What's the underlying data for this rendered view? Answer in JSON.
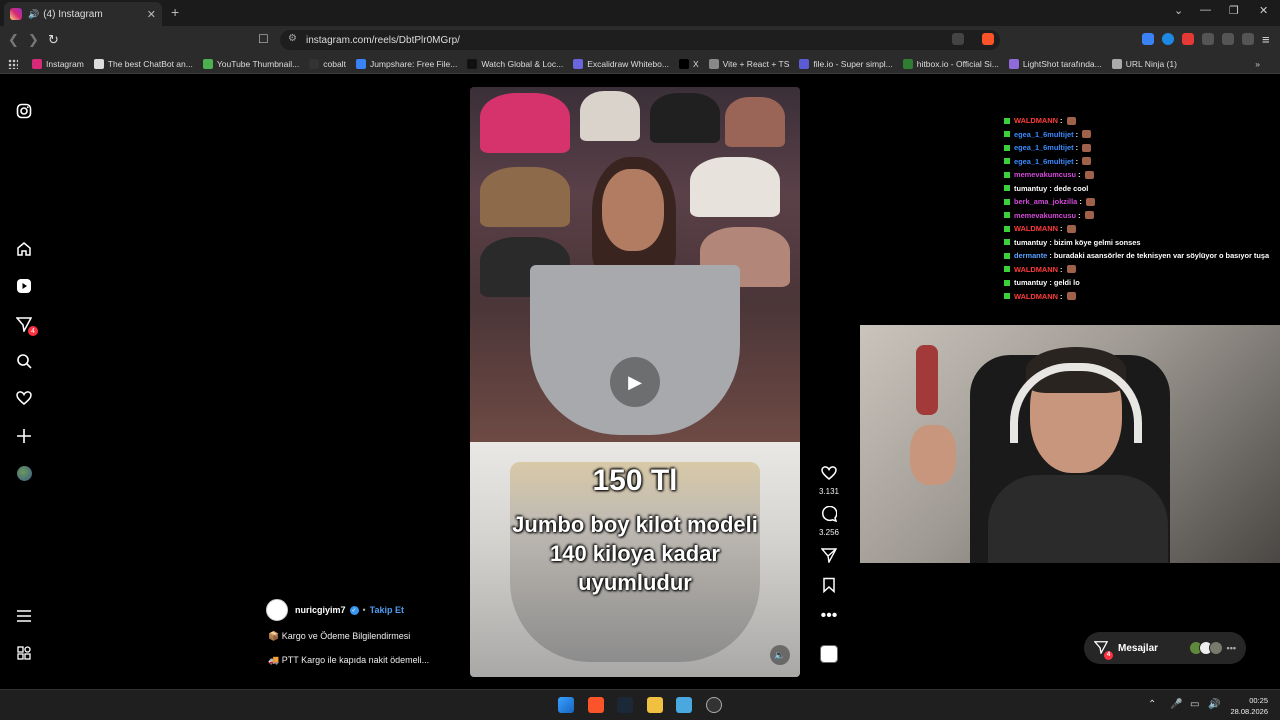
{
  "browser": {
    "tab_title": "(4) Instagram",
    "new_tab": "+",
    "url": "instagram.com/reels/DbtPlr0MGrp/",
    "bookmarks": [
      {
        "label": "Instagram",
        "color": "#d62976"
      },
      {
        "label": "The best ChatBot an...",
        "color": "#dddddd"
      },
      {
        "label": "YouTube Thumbnail...",
        "color": "#4caf50"
      },
      {
        "label": "cobalt",
        "color": "#333333"
      },
      {
        "label": "Jumpshare: Free File...",
        "color": "#3b82f6"
      },
      {
        "label": "Watch Global & Loc...",
        "color": "#111111"
      },
      {
        "label": "Excalidraw Whitebo...",
        "color": "#6965db"
      },
      {
        "label": "X",
        "color": "#000000"
      },
      {
        "label": "Vite + React + TS",
        "color": "#888888"
      },
      {
        "label": "file.io - Super simpl...",
        "color": "#5b5bd6"
      },
      {
        "label": "hitbox.io - Official Si...",
        "color": "#2e7d32"
      },
      {
        "label": "LightShot tarafında...",
        "color": "#8e6bd8"
      },
      {
        "label": "URL Ninja (1)",
        "color": "#aaaaaa"
      }
    ]
  },
  "sidebar": {
    "messages_badge": "4"
  },
  "reel": {
    "price_text": "150 Tl",
    "caption_line1": "Jumbo boy kilot modeli",
    "caption_line2": "140 kiloya kadar",
    "caption_line3": "uyumludur",
    "likes": "3.131",
    "comments": "3.256",
    "author": "nuricgiyim7",
    "follow_label": "Takip Et",
    "separator": "•",
    "desc_line1": "Kargo ve Ödeme Bilgilendirmesi",
    "desc_line2": "PTT Kargo ile kapıda nakit ödemeli..."
  },
  "chat": [
    {
      "user": "WALDMANN",
      "color": "#ff3b3b",
      "msg": ""
    },
    {
      "user": "egea_1_6multijet",
      "color": "#3b8bff",
      "msg": ""
    },
    {
      "user": "egea_1_6multijet",
      "color": "#3b8bff",
      "msg": ""
    },
    {
      "user": "egea_1_6multijet",
      "color": "#3b8bff",
      "msg": ""
    },
    {
      "user": "memevakumcusu",
      "color": "#d24bd8",
      "msg": ""
    },
    {
      "user": "tumantuy",
      "color": "#ffffff",
      "msg": "dede cool"
    },
    {
      "user": "berk_ama_jokzilla",
      "color": "#d24bd8",
      "msg": ""
    },
    {
      "user": "memevakumcusu",
      "color": "#d24bd8",
      "msg": ""
    },
    {
      "user": "WALDMANN",
      "color": "#ff3b3b",
      "msg": ""
    },
    {
      "user": "tumantuy",
      "color": "#ffffff",
      "msg": "bizim köye gelmi sonses"
    },
    {
      "user": "dermante",
      "color": "#5aa0ff",
      "msg": "buradaki asansörler de teknisyen var söylüyor o basıyor tuşa"
    },
    {
      "user": "WALDMANN",
      "color": "#ff3b3b",
      "msg": ""
    },
    {
      "user": "tumantuy",
      "color": "#ffffff",
      "msg": "geldi lo"
    },
    {
      "user": "WALDMANN",
      "color": "#ff3b3b",
      "msg": ""
    }
  ],
  "messages_panel": {
    "label": "Mesajlar",
    "badge": "4"
  },
  "taskbar": {
    "time": "00:25",
    "date": "28.08.2026"
  },
  "colors": {
    "accent_blue": "#4f9cf0",
    "notification_red": "#ff3040"
  }
}
